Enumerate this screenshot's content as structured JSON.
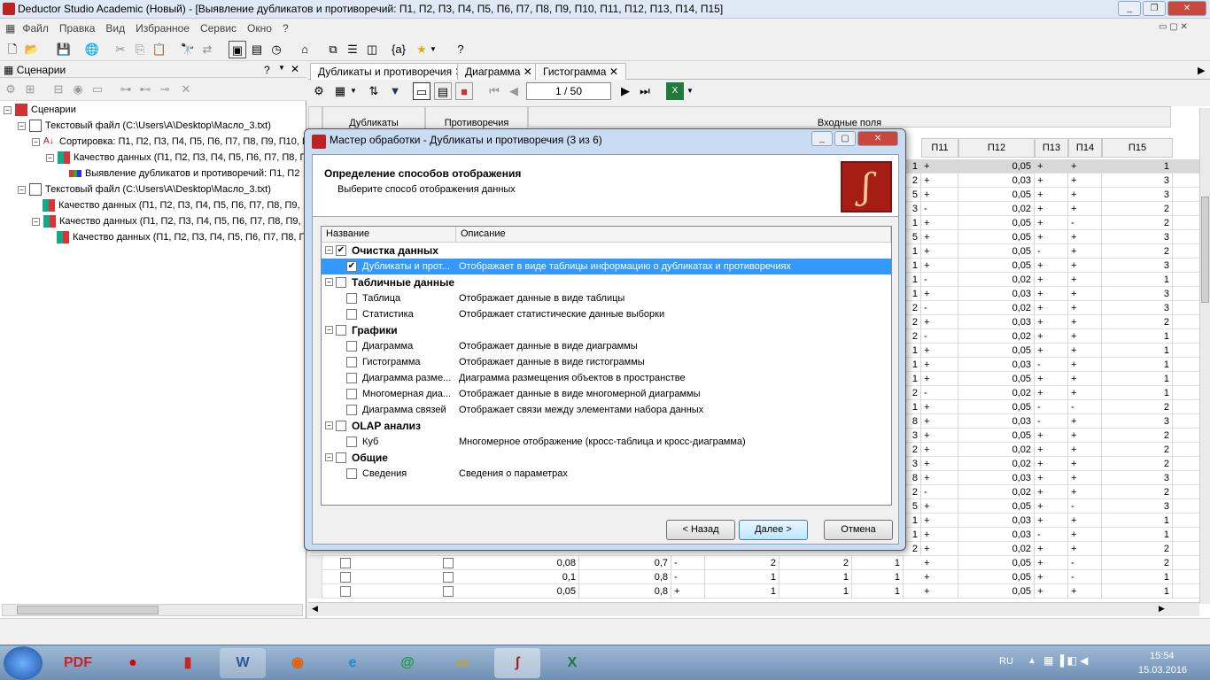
{
  "app": {
    "title": "Deductor Studio Academic (Новый) - [Выявление дубликатов и противоречий: П1, П2, П3, П4, П5, П6, П7, П8, П9, П10, П11, П12, П13, П14, П15]"
  },
  "menu": [
    "Файл",
    "Правка",
    "Вид",
    "Избранное",
    "Сервис",
    "Окно",
    "?"
  ],
  "left_panel": {
    "title": "Сценарии",
    "tree": [
      {
        "label": "Сценарии",
        "level": 0,
        "icon": "scenarios-icon"
      },
      {
        "label": "Текстовый файл (C:\\Users\\A\\Desktop\\Масло_3.txt)",
        "level": 1,
        "icon": "text-file-icon"
      },
      {
        "label": "Сортировка: П1, П2, П3, П4, П5, П6, П7, П8, П9, П10, П",
        "level": 2,
        "icon": "sort-icon"
      },
      {
        "label": "Качество данных (П1, П2, П3, П4, П5, П6, П7, П8, П",
        "level": 3,
        "icon": "quality-icon"
      },
      {
        "label": "Выявление дубликатов и противоречий: П1, П2",
        "level": 4,
        "icon": "duplicates-icon"
      },
      {
        "label": "Текстовый файл (C:\\Users\\A\\Desktop\\Масло_3.txt)",
        "level": 1,
        "icon": "text-file-icon"
      },
      {
        "label": "Качество данных (П1, П2, П3, П4, П5, П6, П7, П8, П9,",
        "level": 2,
        "icon": "quality-icon"
      },
      {
        "label": "Качество данных (П1, П2, П3, П4, П5, П6, П7, П8, П9,",
        "level": 2,
        "icon": "quality-icon"
      },
      {
        "label": "Качество данных (П1, П2, П3, П4, П5, П6, П7, П8, П",
        "level": 3,
        "icon": "quality-icon"
      }
    ]
  },
  "tabs": [
    "Дубликаты и противоречия",
    "Диаграмма",
    "Гистограмма"
  ],
  "nav": {
    "page": "1 / 50"
  },
  "grid": {
    "group_headers": [
      "Дубликаты",
      "Противоречия",
      "Входные поля"
    ],
    "columns": [
      "П11",
      "П12",
      "П13",
      "П14",
      "П15"
    ],
    "rows": [
      [
        "1",
        "+",
        "0,05",
        "+",
        "+",
        "1"
      ],
      [
        "2",
        "+",
        "0,03",
        "+",
        "+",
        "3"
      ],
      [
        "5",
        "+",
        "0,05",
        "+",
        "+",
        "3"
      ],
      [
        "3",
        "-",
        "0,02",
        "+",
        "+",
        "2"
      ],
      [
        "1",
        "+",
        "0,05",
        "+",
        "-",
        "2"
      ],
      [
        "5",
        "+",
        "0,05",
        "+",
        "+",
        "3"
      ],
      [
        "1",
        "+",
        "0,05",
        "-",
        "+",
        "2"
      ],
      [
        "1",
        "+",
        "0,05",
        "+",
        "+",
        "3"
      ],
      [
        "1",
        "-",
        "0,02",
        "+",
        "+",
        "1"
      ],
      [
        "1",
        "+",
        "0,03",
        "+",
        "+",
        "3"
      ],
      [
        "2",
        "-",
        "0,02",
        "+",
        "+",
        "3"
      ],
      [
        "2",
        "+",
        "0,03",
        "+",
        "+",
        "2"
      ],
      [
        "2",
        "-",
        "0,02",
        "+",
        "+",
        "1"
      ],
      [
        "1",
        "+",
        "0,05",
        "+",
        "+",
        "1"
      ],
      [
        "1",
        "+",
        "0,03",
        "-",
        "+",
        "1"
      ],
      [
        "1",
        "+",
        "0,05",
        "+",
        "+",
        "1"
      ],
      [
        "2",
        "-",
        "0,02",
        "+",
        "+",
        "1"
      ],
      [
        "1",
        "+",
        "0,05",
        "-",
        "-",
        "2"
      ],
      [
        "8",
        "+",
        "0,03",
        "-",
        "+",
        "3"
      ],
      [
        "3",
        "+",
        "0,05",
        "+",
        "+",
        "2"
      ],
      [
        "2",
        "+",
        "0,02",
        "+",
        "+",
        "2"
      ],
      [
        "3",
        "+",
        "0,02",
        "+",
        "+",
        "2"
      ],
      [
        "8",
        "+",
        "0,03",
        "+",
        "+",
        "3"
      ],
      [
        "2",
        "-",
        "0,02",
        "+",
        "+",
        "2"
      ],
      [
        "5",
        "+",
        "0,05",
        "+",
        "-",
        "3"
      ],
      [
        "1",
        "+",
        "0,03",
        "+",
        "+",
        "1"
      ],
      [
        "1",
        "+",
        "0,03",
        "-",
        "+",
        "1"
      ],
      [
        "2",
        "+",
        "0,02",
        "+",
        "+",
        "2"
      ]
    ],
    "bottom_rows": [
      [
        "0,08",
        "0,7",
        "-",
        "2",
        "2",
        "1",
        "+",
        "0,05",
        "+",
        "-",
        "2"
      ],
      [
        "0,1",
        "0,8",
        "-",
        "1",
        "1",
        "1",
        "+",
        "0,05",
        "+",
        "-",
        "1"
      ],
      [
        "0,05",
        "0,8",
        "+",
        "1",
        "1",
        "1",
        "+",
        "0,05",
        "+",
        "+",
        "1"
      ]
    ]
  },
  "dialog": {
    "title": "Мастер обработки - Дубликаты и противоречия (3 из 6)",
    "heading": "Определение способов отображения",
    "subheading": "Выберите способ отображения данных",
    "col_name": "Название",
    "col_desc": "Описание",
    "items": [
      {
        "type": "group",
        "name": "Очистка данных",
        "checked": true
      },
      {
        "type": "item",
        "name": "Дубликаты и прот...",
        "desc": "Отображает в виде таблицы информацию о дубликатах и противоречиях",
        "checked": true,
        "selected": true
      },
      {
        "type": "group",
        "name": "Табличные данные",
        "checked": false
      },
      {
        "type": "item",
        "name": "Таблица",
        "desc": "Отображает данные в виде таблицы",
        "checked": false
      },
      {
        "type": "item",
        "name": "Статистика",
        "desc": "Отображает статистические данные выборки",
        "checked": false
      },
      {
        "type": "group",
        "name": "Графики",
        "checked": false
      },
      {
        "type": "item",
        "name": "Диаграмма",
        "desc": "Отображает данные в виде диаграммы",
        "checked": false
      },
      {
        "type": "item",
        "name": "Гистограмма",
        "desc": "Отображает данные в виде гистограммы",
        "checked": false
      },
      {
        "type": "item",
        "name": "Диаграмма разме...",
        "desc": "Диаграмма размещения объектов в пространстве",
        "checked": false
      },
      {
        "type": "item",
        "name": "Многомерная диа...",
        "desc": "Отображает данные в виде многомерной диаграммы",
        "checked": false
      },
      {
        "type": "item",
        "name": "Диаграмма связей",
        "desc": "Отображает связи между элементами набора данных",
        "checked": false
      },
      {
        "type": "group",
        "name": "OLAP анализ",
        "checked": false
      },
      {
        "type": "item",
        "name": "Куб",
        "desc": "Многомерное отображение (кросс-таблица и кросс-диаграмма)",
        "checked": false
      },
      {
        "type": "group",
        "name": "Общие",
        "checked": false
      },
      {
        "type": "item",
        "name": "Сведения",
        "desc": "Сведения о параметрах",
        "checked": false
      }
    ],
    "buttons": {
      "back": "< Назад",
      "next": "Далее >",
      "cancel": "Отмена"
    }
  },
  "taskbar": {
    "lang": "RU",
    "time": "15:54",
    "date": "15.03.2016"
  }
}
